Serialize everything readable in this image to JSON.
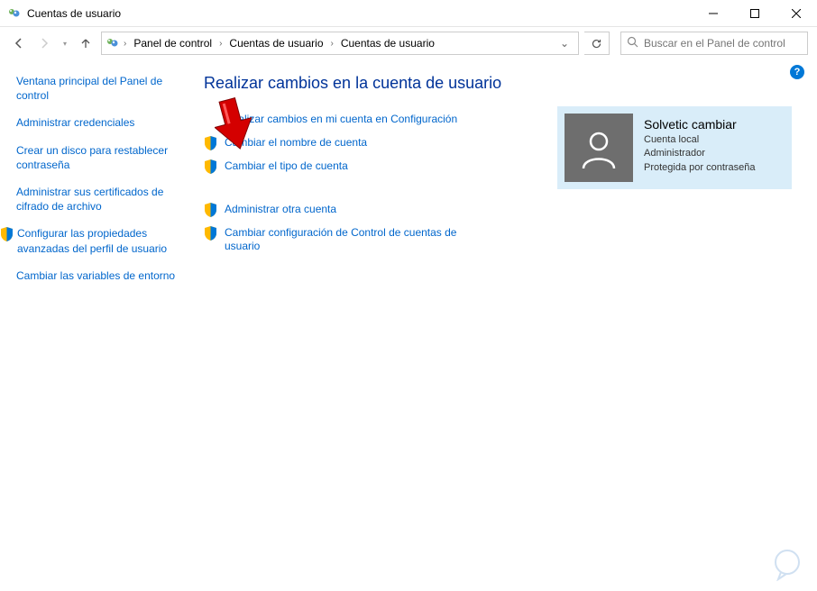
{
  "window": {
    "title": "Cuentas de usuario"
  },
  "breadcrumb": {
    "items": [
      "Panel de control",
      "Cuentas de usuario",
      "Cuentas de usuario"
    ]
  },
  "search": {
    "placeholder": "Buscar en el Panel de control"
  },
  "sidebar": {
    "items": [
      "Ventana principal del Panel de control",
      "Administrar credenciales",
      "Crear un disco para restablecer contraseña",
      "Administrar sus certificados de cifrado de archivo",
      "Configurar las propiedades avanzadas del perfil de usuario",
      "Cambiar las variables de entorno"
    ]
  },
  "main": {
    "header": "Realizar cambios en la cuenta de usuario",
    "links": [
      "Realizar cambios en mi cuenta en Configuración",
      "Cambiar el nombre de cuenta",
      "Cambiar el tipo de cuenta",
      "Administrar otra cuenta",
      "Cambiar configuración de Control de cuentas de usuario"
    ]
  },
  "user": {
    "name": "Solvetic cambiar",
    "line1": "Cuenta local",
    "line2": "Administrador",
    "line3": "Protegida por contraseña"
  }
}
